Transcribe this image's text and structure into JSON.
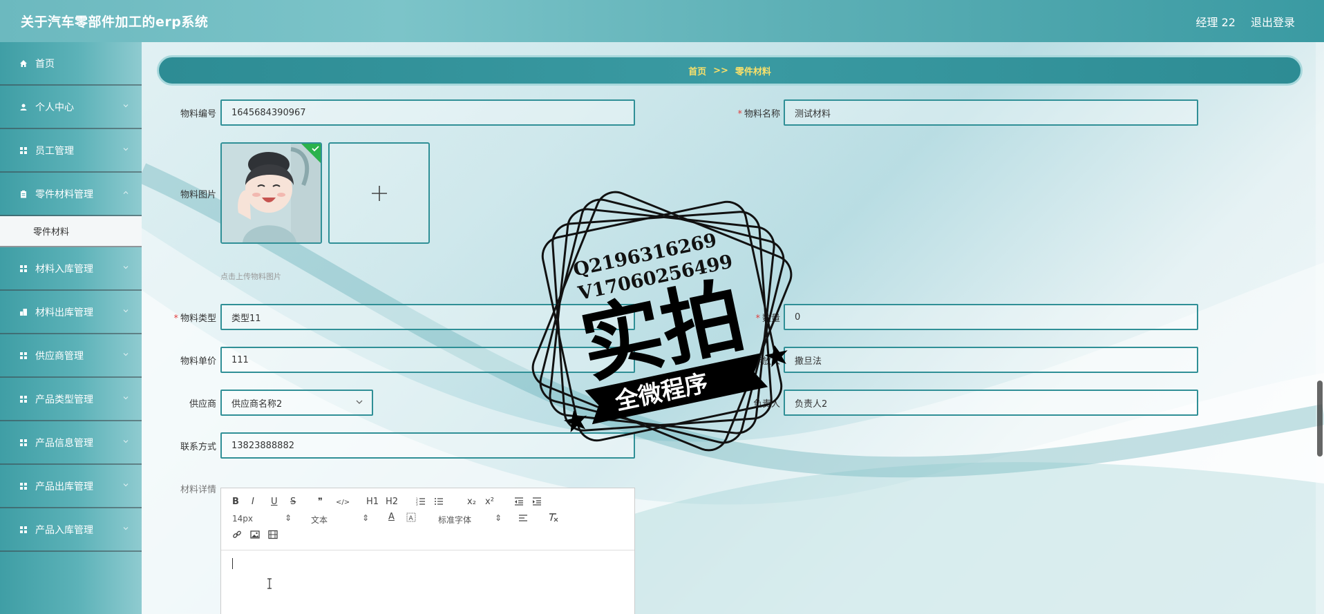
{
  "header": {
    "app_title": "关于汽车零部件加工的erp系统",
    "user": "经理 22",
    "logout": "退出登录"
  },
  "sidebar": {
    "items": [
      {
        "label": "首页",
        "icon": "home-icon"
      },
      {
        "label": "个人中心",
        "icon": "user-icon"
      },
      {
        "label": "员工管理",
        "icon": "grid-icon"
      },
      {
        "label": "零件材料管理",
        "icon": "clipboard-icon"
      },
      {
        "label": "零件材料",
        "icon": ""
      },
      {
        "label": "材料入库管理",
        "icon": "grid-icon"
      },
      {
        "label": "材料出库管理",
        "icon": "building-icon"
      },
      {
        "label": "供应商管理",
        "icon": "grid-icon"
      },
      {
        "label": "产品类型管理",
        "icon": "grid-icon"
      },
      {
        "label": "产品信息管理",
        "icon": "grid-icon"
      },
      {
        "label": "产品出库管理",
        "icon": "grid-icon"
      },
      {
        "label": "产品入库管理",
        "icon": "grid-icon"
      }
    ]
  },
  "breadcrumb": {
    "home": "首页",
    "sep": ">>",
    "current": "零件材料"
  },
  "form": {
    "code_label": "物料编号",
    "code_value": "1645684390967",
    "name_label": "物料名称",
    "name_value": "测试材料",
    "image_label": "物料图片",
    "upload_hint": "点击上传物料图片",
    "type_label": "物料类型",
    "type_value": "类型11",
    "qty_label": "数量",
    "qty_value": "0",
    "price_label": "物料单价",
    "price_value": "111",
    "owner_type_label": "存放人",
    "owner_type_value": "撒旦法",
    "supplier_label": "供应商",
    "supplier_value": "供应商名称2",
    "manager_label": "负责人",
    "manager_value": "负责人2",
    "contact_label": "联系方式",
    "contact_value": "13823888882",
    "detail_label": "材料详情"
  },
  "editor": {
    "font_size": "14px",
    "block": "文本",
    "font": "标准字体",
    "tools": [
      "B",
      "I",
      "U",
      "S",
      "❞",
      "</>",
      "H1",
      "H2",
      "ol",
      "ul",
      "x₂",
      "x²",
      "outdent",
      "indent"
    ]
  },
  "watermark": {
    "line1": "Q2196316269",
    "line2": "V17060256499",
    "big": "实拍",
    "ribbon": "全微程序"
  }
}
